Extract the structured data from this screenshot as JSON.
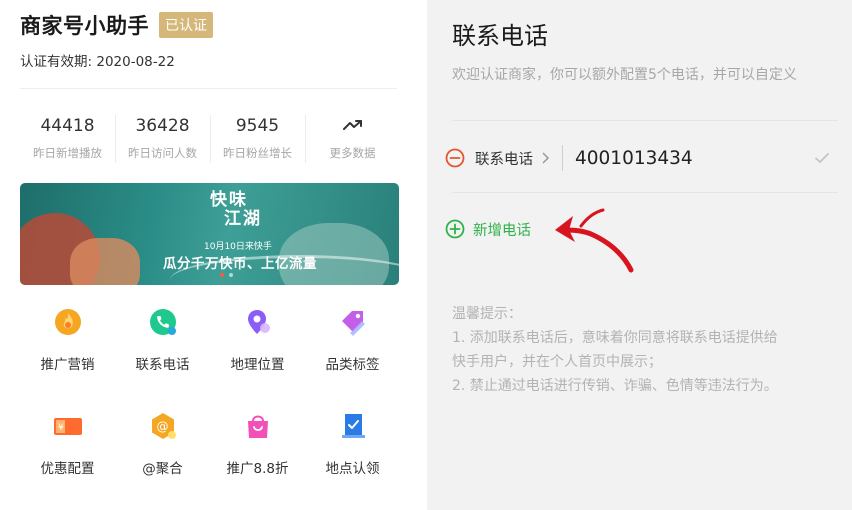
{
  "left": {
    "shop_title": "商家号小助手",
    "cert_badge": "已认证",
    "validity_label": "认证有效期:",
    "validity_date": "2020-08-22",
    "stats": [
      {
        "value": "44418",
        "label": "昨日新增播放"
      },
      {
        "value": "36428",
        "label": "昨日访问人数"
      },
      {
        "value": "9545",
        "label": "昨日粉丝增长"
      },
      {
        "value": "",
        "label": "更多数据",
        "icon": "trend-icon"
      }
    ],
    "banner": {
      "calligraphy_line1": "快味",
      "calligraphy_line2": "江湖",
      "date": "10月10日来快手",
      "slogan": "瓜分千万快币、上亿流量"
    },
    "grid": [
      {
        "label": "推广营销",
        "icon": "fire-icon",
        "color": "#f5a623"
      },
      {
        "label": "联系电话",
        "icon": "phone-icon",
        "color": "#1fc98e"
      },
      {
        "label": "地理位置",
        "icon": "location-pin-icon",
        "color": "#8b5cf6"
      },
      {
        "label": "品类标签",
        "icon": "tag-icon",
        "color": "#c45de8"
      },
      {
        "label": "优惠配置",
        "icon": "coupon-icon",
        "color": "#ff6a2f"
      },
      {
        "label": "@聚合",
        "icon": "at-icon",
        "color": "#f5a623"
      },
      {
        "label": "推广8.8折",
        "icon": "shopping-bag-icon",
        "color": "#f24fb8"
      },
      {
        "label": "地点认领",
        "icon": "building-icon",
        "color": "#2b7be6"
      }
    ]
  },
  "right": {
    "title": "联系电话",
    "description": "欢迎认证商家，你可以额外配置5个电话，并可以自定义",
    "phone_label": "联系电话",
    "phone_value": "4001013434",
    "add_label": "新增电话",
    "tips_title": "温馨提示：",
    "tip1_line1": "1. 添加联系电话后，意味着你同意将联系电话提供给",
    "tip1_line2": "快手用户，并在个人首页中展示；",
    "tip2": "2. 禁止通过电话进行传销、诈骗、色情等违法行为。"
  },
  "colors": {
    "gold_badge": "#d6b77a",
    "red_minus": "#e5542e",
    "green_add": "#2fb24a",
    "arrow_red": "#d8141e"
  }
}
